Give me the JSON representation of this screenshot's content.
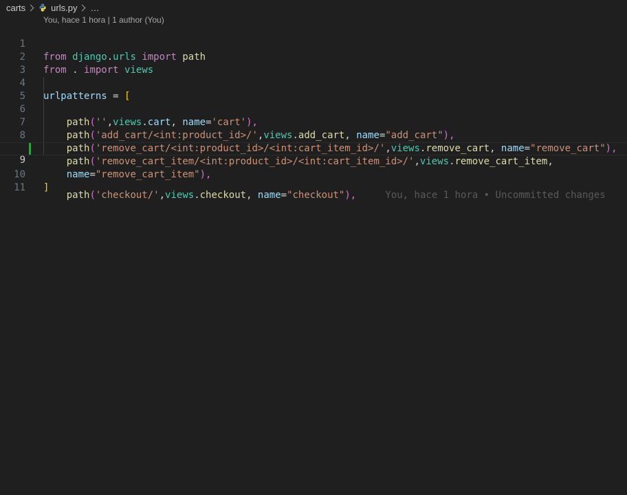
{
  "breadcrumb": {
    "folder": "carts",
    "file": "urls.py",
    "more": "…"
  },
  "blame_header": "You, hace 1 hora | 1 author (You)",
  "inline_blame": "You, hace 1 hora • Uncommitted changes",
  "line_numbers": [
    "1",
    "2",
    "3",
    "4",
    "5",
    "6",
    "7",
    "8",
    "",
    "9",
    "10",
    "11"
  ],
  "code": {
    "l1": [
      "from",
      " ",
      "django",
      ".",
      "urls",
      " ",
      "import",
      " ",
      "path"
    ],
    "l2": [
      "from",
      " . ",
      "import",
      " ",
      "views"
    ],
    "l4": [
      "urlpatterns",
      " = ",
      "["
    ],
    "l5": [
      "path",
      "(",
      "''",
      ",",
      "views",
      ".",
      "cart",
      ", ",
      "name",
      "=",
      "'cart'",
      "),"
    ],
    "l6": [
      "path",
      "(",
      "'add_cart/<int:product_id>/'",
      ",",
      "views",
      ".",
      "add_cart",
      ", ",
      "name",
      "=",
      "\"add_cart\"",
      "),"
    ],
    "l7": [
      "path",
      "(",
      "'remove_cart/<int:product_id>/<int:cart_item_id>/'",
      ",",
      "views",
      ".",
      "remove_cart",
      ", ",
      "name",
      "=",
      "\"remove_cart\"",
      "),"
    ],
    "l8a": [
      "path",
      "(",
      "'remove_cart_item/<int:product_id>/<int:cart_item_id>/'",
      ",",
      "views",
      ".",
      "remove_cart_item",
      ","
    ],
    "l8b": [
      "name",
      "=",
      "\"remove_cart_item\"",
      "),"
    ],
    "l9": [
      "path",
      "(",
      "'checkout/'",
      ",",
      "views",
      ".",
      "checkout",
      ", ",
      "name",
      "=",
      "\"checkout\"",
      "),"
    ],
    "l10": [
      "]"
    ]
  },
  "colors": {
    "background": "#1f1f1f",
    "gutter_added": "#2ea043"
  },
  "icons": {
    "breadcrumb_separator": "chevron-right-icon",
    "file_type": "python-icon"
  }
}
